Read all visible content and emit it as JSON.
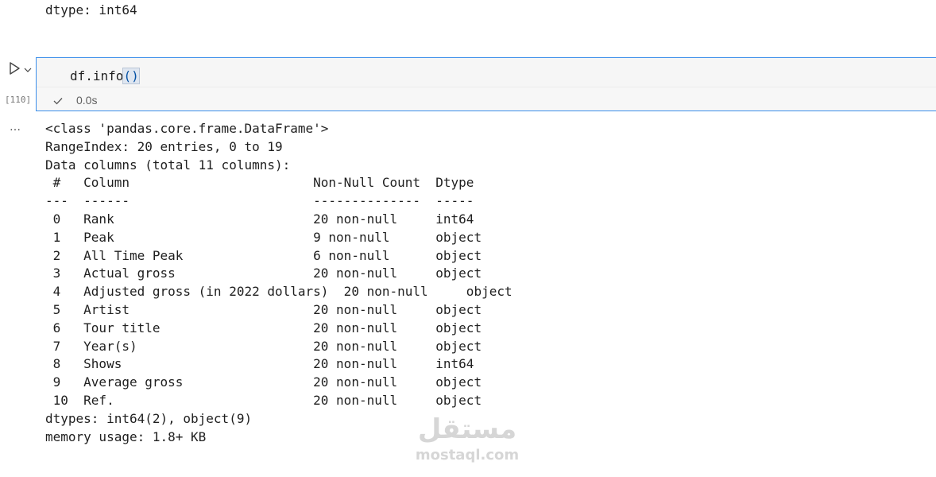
{
  "previous_output": {
    "text": "dtype: int64"
  },
  "cell": {
    "execution_count": "[110]",
    "code_prefix": "df.info",
    "code_parens": "()",
    "exec_time": "0.0s",
    "icons": {
      "run": "play-icon",
      "menu": "chevron-down-icon",
      "status": "check-icon",
      "output_menu": "ellipsis-icon"
    },
    "accent_color": "#3b8eea"
  },
  "output": {
    "menu_label": "…",
    "lines": [
      "<class 'pandas.core.frame.DataFrame'>",
      "RangeIndex: 20 entries, 0 to 19",
      "Data columns (total 11 columns):",
      " #   Column                        Non-Null Count  Dtype ",
      "---  ------                        --------------  ----- ",
      " 0   Rank                          20 non-null     int64 ",
      " 1   Peak                          9 non-null      object",
      " 2   All Time Peak                 6 non-null      object",
      " 3   Actual gross                  20 non-null     object",
      " 4   Adjusted gross (in 2022 dollars)  20 non-null     object",
      " 5   Artist                        20 non-null     object",
      " 6   Tour title                    20 non-null     object",
      " 7   Year(s)                       20 non-null     object",
      " 8   Shows                         20 non-null     int64 ",
      " 9   Average gross                 20 non-null     object",
      " 10  Ref.                          20 non-null     object",
      "dtypes: int64(2), object(9)",
      "memory usage: 1.8+ KB"
    ]
  },
  "watermark": {
    "arabic": "مستقل",
    "latin": "mostaql.com"
  }
}
